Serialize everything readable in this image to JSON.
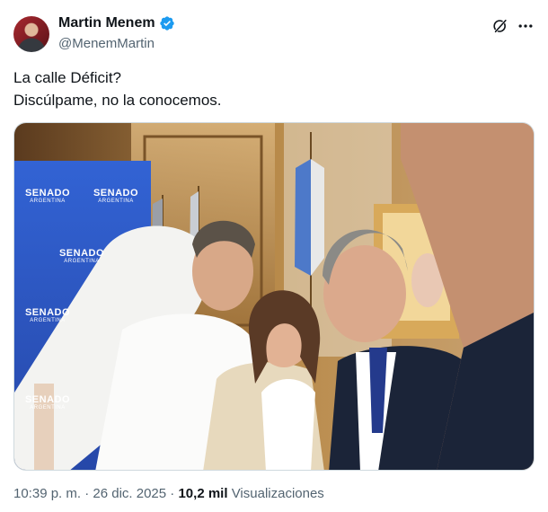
{
  "author": {
    "display_name": "Martin Menem",
    "handle": "@MenemMartin",
    "verified": true,
    "verified_color": "#1d9bf0"
  },
  "header_icons": {
    "grok": "grok-icon",
    "more": "more-options-icon"
  },
  "tweet": {
    "lines": [
      "La calle Déficit?",
      "Discúlpame, no la conocemos."
    ]
  },
  "media": {
    "type": "photo",
    "banner_text": "SENADO",
    "banner_subtext": "ARGENTINA",
    "banner_color": "#2d55c4"
  },
  "meta": {
    "time": "10:39 p. m.",
    "separator": "·",
    "date": "26 dic. 2025",
    "views_count": "10,2 mil",
    "views_label": "Visualizaciones"
  }
}
